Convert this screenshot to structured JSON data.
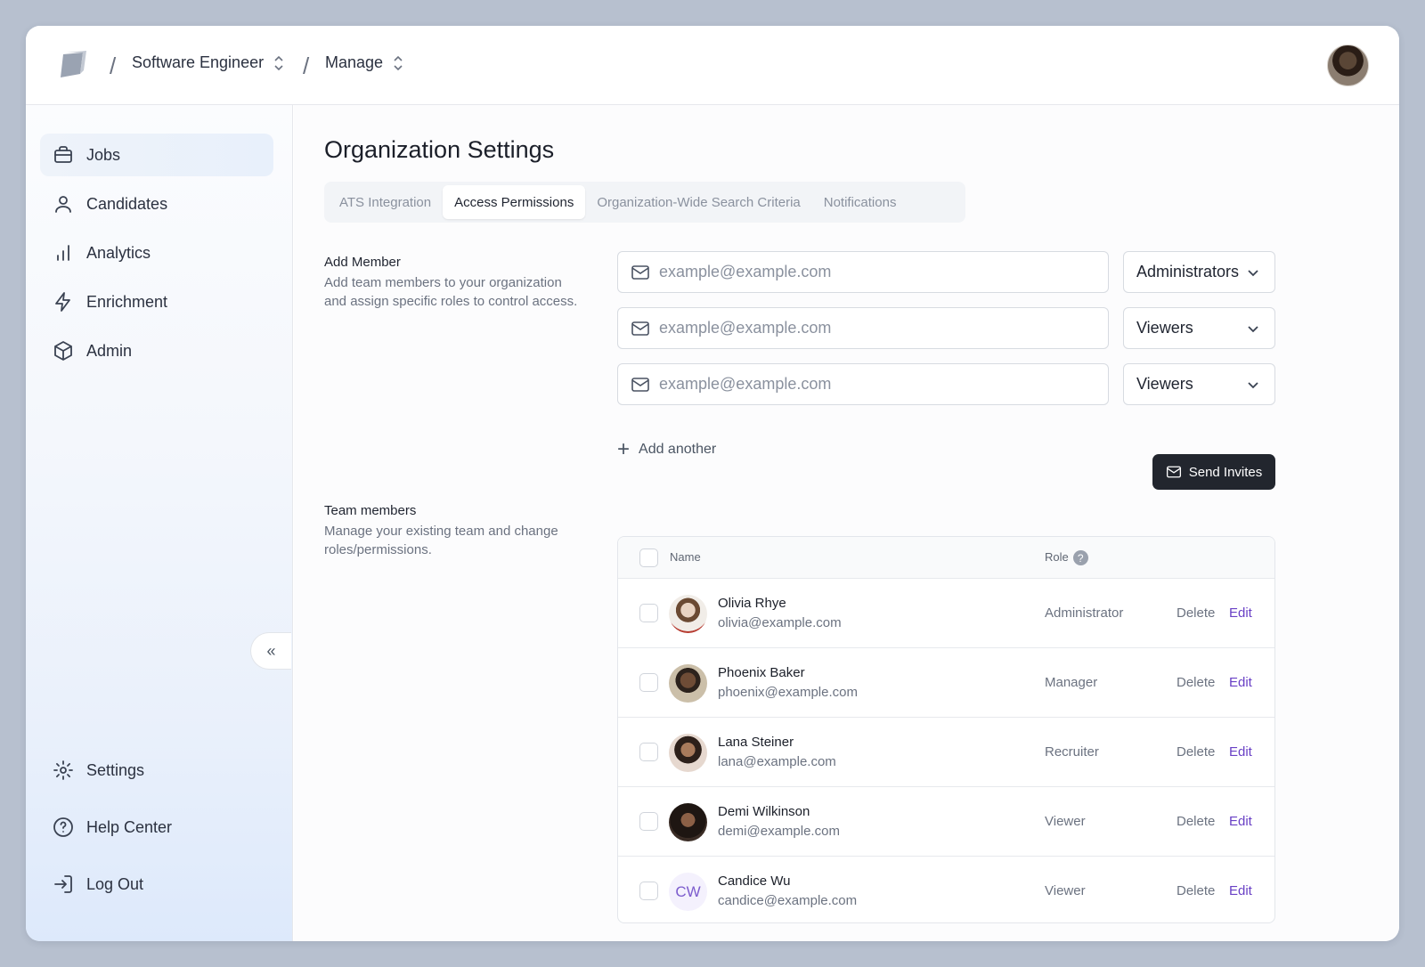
{
  "breadcrumb": {
    "items": [
      {
        "label": "Software Engineer"
      },
      {
        "label": "Manage"
      }
    ],
    "separator": "/"
  },
  "sidebar": {
    "items": [
      {
        "label": "Jobs",
        "icon": "briefcase-icon",
        "active": true
      },
      {
        "label": "Candidates",
        "icon": "user-icon"
      },
      {
        "label": "Analytics",
        "icon": "bar-chart-icon"
      },
      {
        "label": "Enrichment",
        "icon": "lightning-icon"
      },
      {
        "label": "Admin",
        "icon": "cube-icon"
      }
    ],
    "bottom_items": [
      {
        "label": "Settings",
        "icon": "gear-icon"
      },
      {
        "label": "Help Center",
        "icon": "help-circle-icon"
      },
      {
        "label": "Log Out",
        "icon": "logout-icon"
      }
    ],
    "collapse_glyph": "«"
  },
  "main": {
    "title": "Organization Settings",
    "tabs": [
      {
        "label": "ATS Integration"
      },
      {
        "label": "Access Permissions",
        "active": true
      },
      {
        "label": "Organization-Wide Search Criteria"
      },
      {
        "label": "Notifications"
      }
    ],
    "add_member": {
      "title": "Add Member",
      "description": "Add team members to your organization and assign specific roles to control access.",
      "rows": [
        {
          "placeholder": "example@example.com",
          "role": "Administrators"
        },
        {
          "placeholder": "example@example.com",
          "role": "Viewers"
        },
        {
          "placeholder": "example@example.com",
          "role": "Viewers"
        }
      ],
      "add_another_label": "Add another",
      "send_label": "Send Invites"
    },
    "team": {
      "title": "Team members",
      "description": "Manage your existing team and change roles/permissions.",
      "col_name": "Name",
      "col_role": "Role",
      "help_glyph": "?",
      "delete_label": "Delete",
      "edit_label": "Edit",
      "members": [
        {
          "name": "Olivia Rhye",
          "email": "olivia@example.com",
          "role": "Administrator"
        },
        {
          "name": "Phoenix Baker",
          "email": "phoenix@example.com",
          "role": "Manager"
        },
        {
          "name": "Lana Steiner",
          "email": "lana@example.com",
          "role": "Recruiter"
        },
        {
          "name": "Demi Wilkinson",
          "email": "demi@example.com",
          "role": "Viewer"
        },
        {
          "name": "Candice Wu",
          "email": "candice@example.com",
          "role": "Viewer",
          "initials": "CW"
        }
      ]
    }
  },
  "colors": {
    "accent_edit": "#6940c5",
    "primary_button": "#22262e",
    "page_background": "#b7c0cf"
  }
}
